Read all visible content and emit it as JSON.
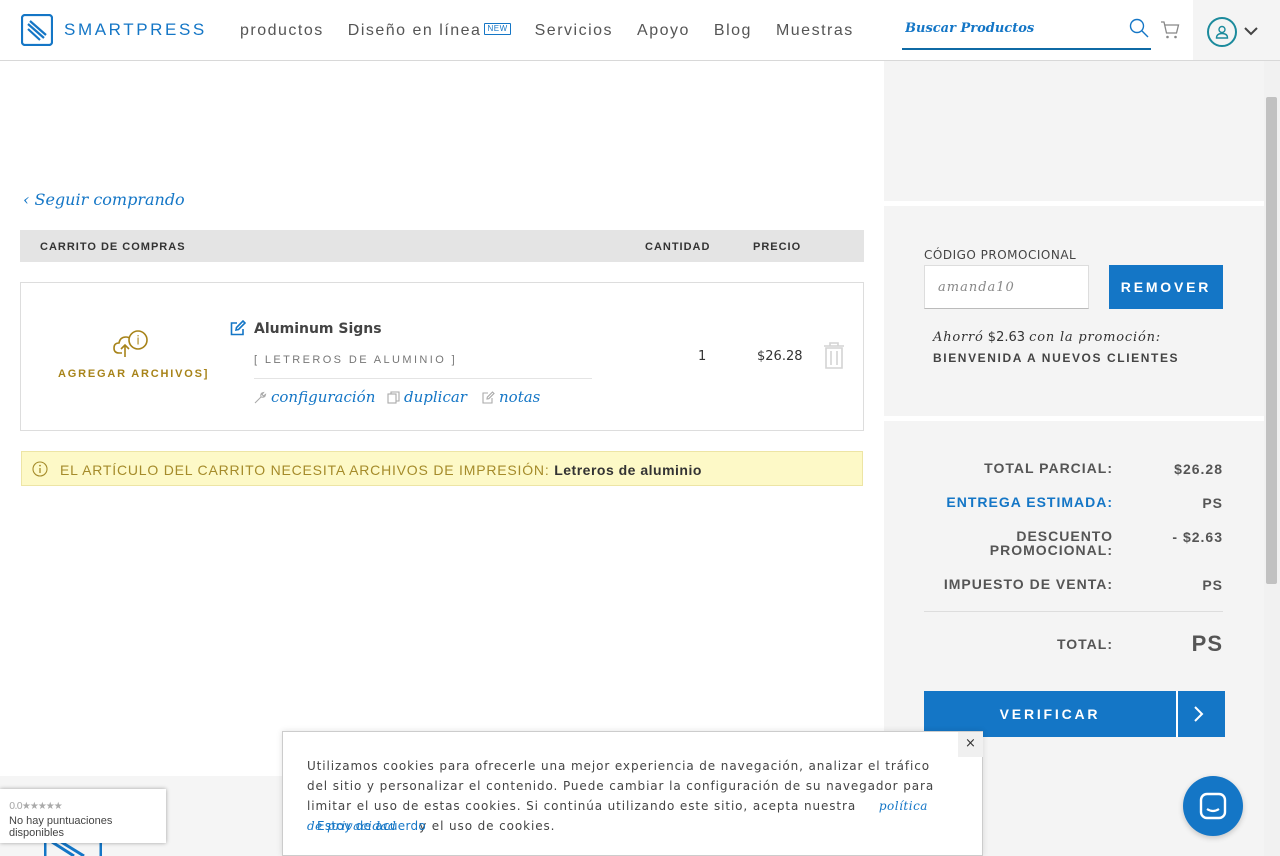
{
  "header": {
    "brand": "SMARTPRESS",
    "nav": [
      {
        "label": "productos"
      },
      {
        "label": "Diseño en línea",
        "badge": "NEW"
      },
      {
        "label": "Servicios"
      },
      {
        "label": "Apoyo"
      },
      {
        "label": "Blog"
      },
      {
        "label": "Muestras"
      }
    ],
    "search_placeholder": "Buscar Productos"
  },
  "cart": {
    "continue_label": "‹ Seguir comprando",
    "columns": {
      "product": "CARRITO DE COMPRAS",
      "quantity": "CANTIDAD",
      "price": "PRECIO"
    },
    "item": {
      "upload_label": "AGREGAR ARCHIVOS]",
      "title": "Aluminum Signs",
      "subtitle": "[ LETREROS DE ALUMINIO ]",
      "actions": {
        "config": "configuración",
        "duplicate": "duplicar",
        "notes": "notas"
      },
      "quantity": "1",
      "price": "$26.28"
    },
    "alert": {
      "text": "EL ARTÍCULO DEL CARRITO NECESITA ARCHIVOS DE IMPRESIÓN:",
      "item": "Letreros de aluminio"
    }
  },
  "promo": {
    "label": "CÓDIGO PROMOCIONAL",
    "code": "amanda10",
    "remove_label": "REMOVER",
    "saved_prefix": "Ahorró",
    "saved_amount": "$2.63",
    "saved_suffix": "con la promoción:",
    "promo_name": "BIENVENIDA A NUEVOS CLIENTES"
  },
  "summary": {
    "subtotal_label": "TOTAL PARCIAL:",
    "subtotal": "$26.28",
    "delivery_label": "ENTREGA ESTIMADA:",
    "delivery": "PS",
    "discount_label_1": "DESCUENTO",
    "discount_label_2": "PROMOCIONAL:",
    "discount": "- $2.63",
    "tax_label": "IMPUESTO DE VENTA:",
    "tax": "PS",
    "total_label": "TOTAL:",
    "total": "PS",
    "checkout_label": "VERIFICAR"
  },
  "cookie": {
    "text_1": "Utilizamos cookies para ofrecerle una mejor experiencia de navegación, analizar el tráfico del sitio y personalizar el contenido. Puede cambiar la configuración de su navegador para limitar el uso de estas cookies. Si continúa utilizando este sitio, acepta nuestra",
    "privacy_link": "política de privacidad",
    "text_2": "y el uso de cookies.",
    "agree_label": "Estoy de acuerdo",
    "close": "×"
  },
  "rating": {
    "score": "0.0",
    "stars": "★★★★★",
    "text": "No hay puntuaciones disponibles"
  },
  "colors": {
    "accent": "#1476c6",
    "gold": "#a78319",
    "alert_bg": "#fdf9c7",
    "panel_bg": "#f4f4f4"
  }
}
